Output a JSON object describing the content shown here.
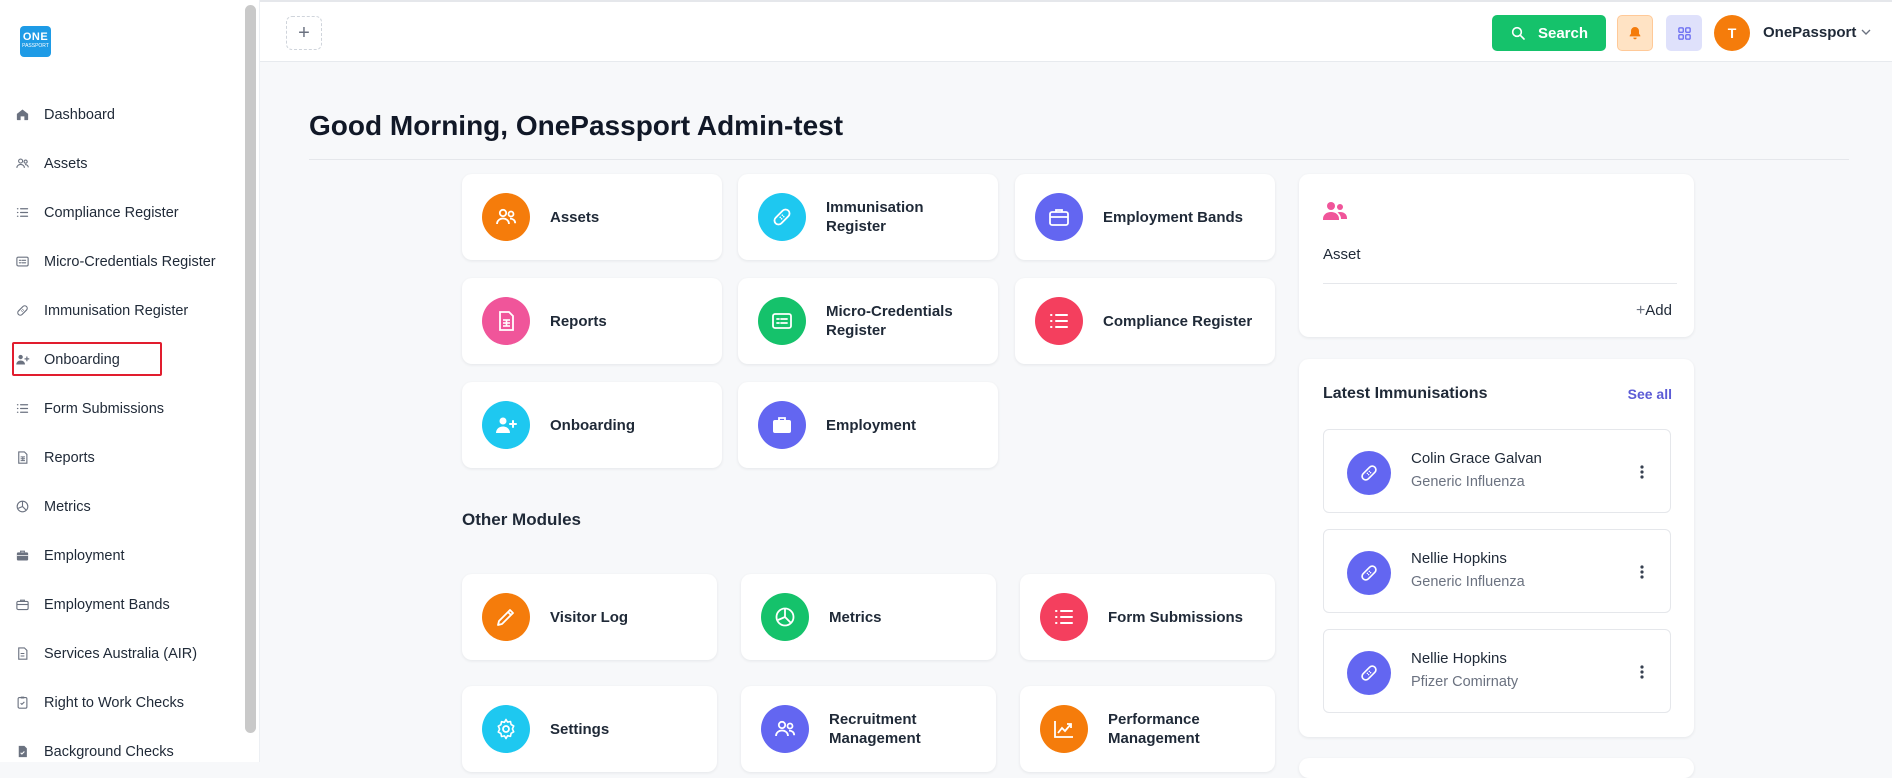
{
  "logo": {
    "line1": "ONE",
    "line2": "PASSPORT"
  },
  "sidebar": {
    "items": [
      {
        "label": "Dashboard",
        "icon": "home-icon"
      },
      {
        "label": "Assets",
        "icon": "users-icon"
      },
      {
        "label": "Compliance Register",
        "icon": "list-icon"
      },
      {
        "label": "Micro-Credentials Register",
        "icon": "id-card-icon"
      },
      {
        "label": "Immunisation Register",
        "icon": "bandage-icon"
      },
      {
        "label": "Onboarding",
        "icon": "user-plus-icon",
        "active": true
      },
      {
        "label": "Form Submissions",
        "icon": "list-icon"
      },
      {
        "label": "Reports",
        "icon": "report-icon"
      },
      {
        "label": "Metrics",
        "icon": "pie-icon"
      },
      {
        "label": "Employment",
        "icon": "briefcase-icon"
      },
      {
        "label": "Employment Bands",
        "icon": "briefcase-outline-icon"
      },
      {
        "label": "Services Australia (AIR)",
        "icon": "document-icon"
      },
      {
        "label": "Right to Work Checks",
        "icon": "clipboard-check-icon"
      },
      {
        "label": "Background Checks",
        "icon": "file-check-icon"
      }
    ]
  },
  "topbar": {
    "add_tab": "+",
    "search_label": "Search",
    "avatar_initial": "T",
    "user_name": "OnePassport"
  },
  "greeting": "Good Morning, OnePassport Admin-test",
  "modules": [
    {
      "label": "Assets",
      "color": "#f57c0b",
      "icon": "users-icon"
    },
    {
      "label": "Immunisation Register",
      "color": "#1ec8f0",
      "icon": "bandage-icon"
    },
    {
      "label": "Employment Bands",
      "color": "#6366f1",
      "icon": "briefcase-outline-icon"
    },
    {
      "label": "Reports",
      "color": "#f0559a",
      "icon": "report-icon"
    },
    {
      "label": "Micro-Credentials Register",
      "color": "#15c26b",
      "icon": "id-card-icon"
    },
    {
      "label": "Compliance Register",
      "color": "#f43f5e",
      "icon": "list-icon"
    },
    {
      "label": "Onboarding",
      "color": "#1ec8f0",
      "icon": "user-plus-icon"
    },
    {
      "label": "Employment",
      "color": "#6366f1",
      "icon": "briefcase-icon"
    }
  ],
  "other_modules_title": "Other Modules",
  "other_modules": [
    {
      "label": "Visitor Log",
      "color": "#f57c0b",
      "icon": "pencil-icon"
    },
    {
      "label": "Metrics",
      "color": "#15c26b",
      "icon": "pie-icon"
    },
    {
      "label": "Form Submissions",
      "color": "#f43f5e",
      "icon": "list-icon"
    },
    {
      "label": "Settings",
      "color": "#1ec8f0",
      "icon": "gear-icon"
    },
    {
      "label": "Recruitment Management",
      "color": "#6366f1",
      "icon": "users-icon"
    },
    {
      "label": "Performance Management",
      "color": "#f57c0b",
      "icon": "chart-icon"
    }
  ],
  "asset_panel": {
    "title": "Asset",
    "add_label": "Add"
  },
  "immunisations": {
    "title": "Latest Immunisations",
    "see_all": "See all",
    "items": [
      {
        "name": "Colin Grace Galvan",
        "vaccine": "Generic Influenza"
      },
      {
        "name": "Nellie Hopkins",
        "vaccine": "Generic Influenza"
      },
      {
        "name": "Nellie Hopkins",
        "vaccine": "Pfizer Comirnaty"
      }
    ]
  },
  "colors": {
    "accent_green": "#15c26b",
    "accent_indigo": "#6366f1",
    "highlight_red": "#e11d2e",
    "avatar_orange": "#f57c0b"
  }
}
